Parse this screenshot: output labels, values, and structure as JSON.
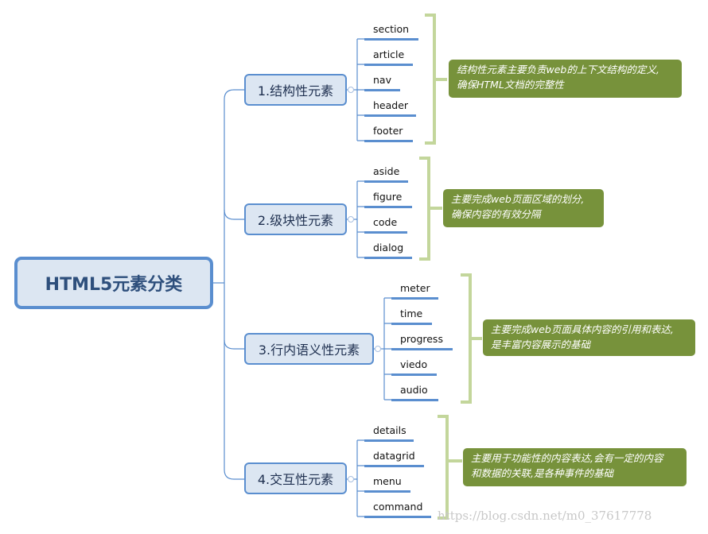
{
  "root": {
    "label": "HTML5元素分类"
  },
  "categories": [
    {
      "label": "1.结构性元素",
      "items": [
        "section",
        "article",
        "nav",
        "header",
        "footer"
      ],
      "note": [
        "结构性元素主要负责web的上下文结构的定义,",
        "确保HTML文档的完整性"
      ]
    },
    {
      "label": "2.级块性元素",
      "items": [
        "aside",
        "figure",
        "code",
        "dialog"
      ],
      "note": [
        "主要完成web页面区域的划分,",
        "确保内容的有效分隔"
      ]
    },
    {
      "label": "3.行内语义性元素",
      "items": [
        "meter",
        "time",
        "progress",
        "viedo",
        "audio"
      ],
      "note": [
        "主要完成web页面具体内容的引用和表达,",
        "是丰富内容展示的基础"
      ]
    },
    {
      "label": "4.交互性元素",
      "items": [
        "details",
        "datagrid",
        "menu",
        "command"
      ],
      "note": [
        "主要用于功能性的内容表达,会有一定的内容",
        "和数据的关联,是各种事件的基础"
      ]
    }
  ],
  "watermark": "https://blog.csdn.net/m0_37617778",
  "colors": {
    "node_border": "#5a8ecf",
    "node_fill": "#dce6f2",
    "note_fill": "#77923b",
    "bracket": "#c3d69b"
  }
}
